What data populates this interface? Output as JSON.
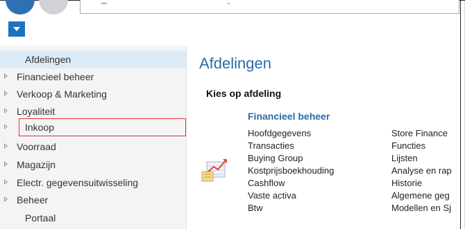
{
  "colors": {
    "accent": "#2b6ba8",
    "menu_button": "#1e73be",
    "selection": "#ddebf7",
    "highlight_box": "#e02f3e"
  },
  "toolbar": {
    "menu_button_icon": "chevron-down-icon"
  },
  "sidebar": {
    "items": [
      {
        "label": "Afdelingen",
        "expandable": false,
        "selected": true
      },
      {
        "label": "Financieel beheer",
        "expandable": true
      },
      {
        "label": "Verkoop & Marketing",
        "expandable": true
      },
      {
        "label": "Loyaliteit",
        "expandable": true
      },
      {
        "label": "Inkoop",
        "expandable": true,
        "highlighted": true
      },
      {
        "label": "Voorraad",
        "expandable": true
      },
      {
        "label": "Magazijn",
        "expandable": true
      },
      {
        "label": "Electr. gegevensuitwisseling",
        "expandable": true
      },
      {
        "label": "Beheer",
        "expandable": true
      },
      {
        "label": "Portaal",
        "expandable": false
      }
    ]
  },
  "main": {
    "title": "Afdelingen",
    "subtitle": "Kies op afdeling",
    "group": {
      "title": "Financieel beheer",
      "icon": "chart-icon",
      "column1": [
        "Hoofdgegevens",
        "Transacties",
        "Buying Group",
        "Kostprijsboekhouding",
        "Cashflow",
        "Vaste activa",
        "Btw"
      ],
      "column2": [
        "Store Finance",
        "Functies",
        "Lijsten",
        "Analyse en rap",
        "Historie",
        "Algemene geg",
        "Modellen en Sj"
      ]
    }
  }
}
